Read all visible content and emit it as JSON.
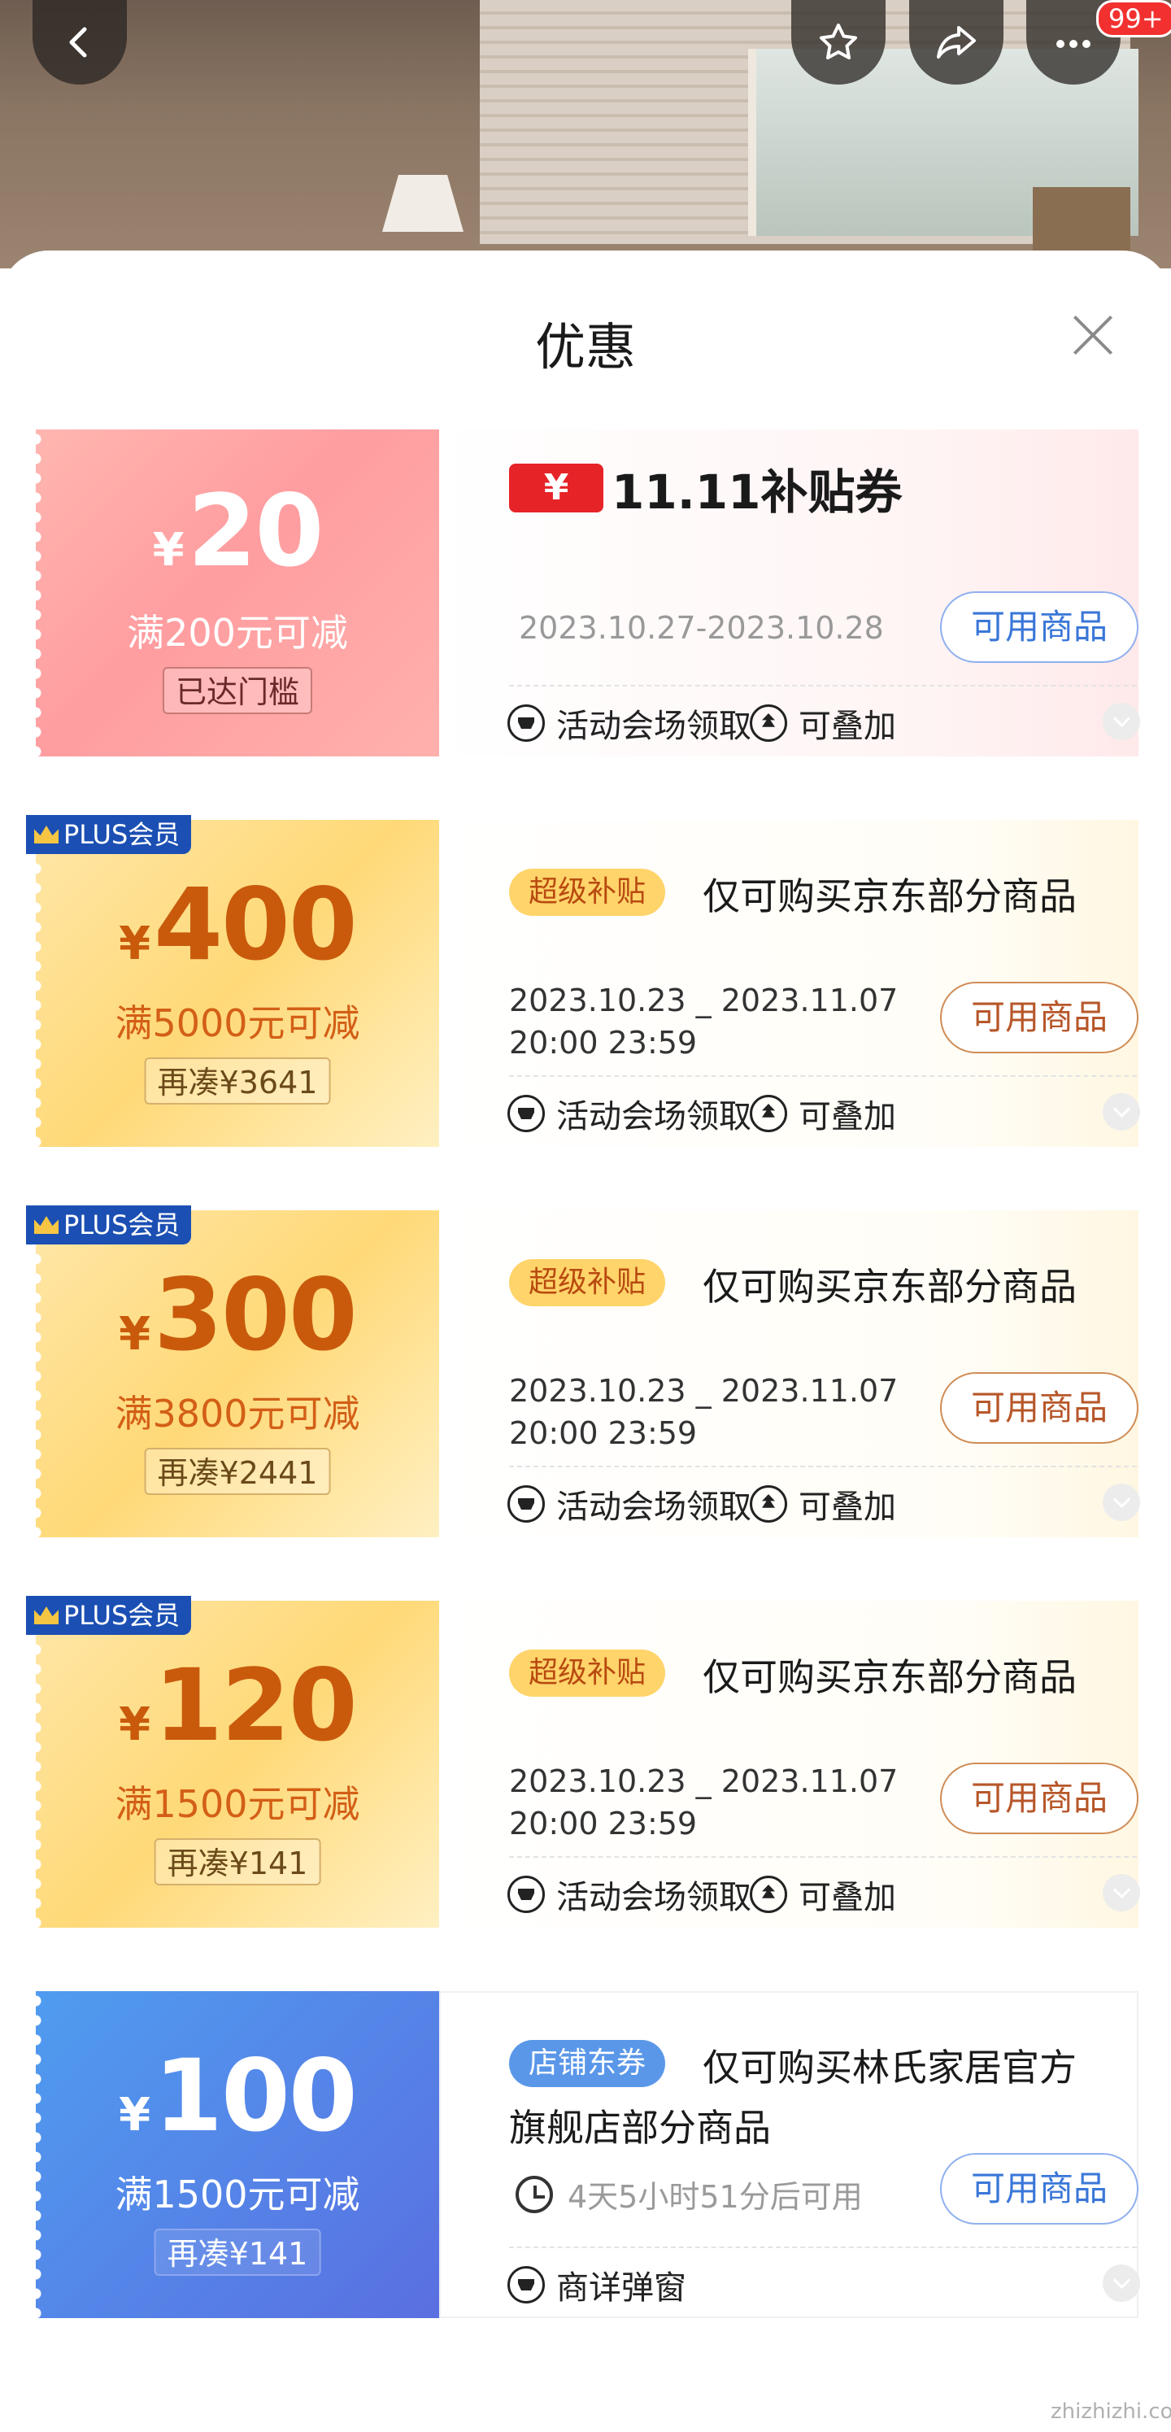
{
  "header": {
    "badge": "99+"
  },
  "sheet": {
    "title": "优惠"
  },
  "coupons": [
    {
      "style": "red",
      "yen": "¥",
      "amount": "20",
      "condition": "满200元可减",
      "tag": "已达门槛",
      "brand_yen": "¥",
      "brand_text": "11.11补贴券",
      "date_line1": "2023.10.27-2023.10.28",
      "button": "可用商品",
      "feat1": "活动会场领取",
      "feat2": "可叠加"
    },
    {
      "style": "gold",
      "plus": "PLUS会员",
      "yen": "¥",
      "amount": "400",
      "condition": "满5000元可减",
      "tag": "再凑¥3641",
      "pill": "超级补贴",
      "title": "仅可购买京东部分商品",
      "date_line1": "2023.10.23 _ 2023.11.07",
      "date_line2": "20:00 23:59",
      "button": "可用商品",
      "feat1": "活动会场领取",
      "feat2": "可叠加"
    },
    {
      "style": "gold",
      "plus": "PLUS会员",
      "yen": "¥",
      "amount": "300",
      "condition": "满3800元可减",
      "tag": "再凑¥2441",
      "pill": "超级补贴",
      "title": "仅可购买京东部分商品",
      "date_line1": "2023.10.23 _ 2023.11.07",
      "date_line2": "20:00 23:59",
      "button": "可用商品",
      "feat1": "活动会场领取",
      "feat2": "可叠加"
    },
    {
      "style": "gold",
      "plus": "PLUS会员",
      "yen": "¥",
      "amount": "120",
      "condition": "满1500元可减",
      "tag": "再凑¥141",
      "pill": "超级补贴",
      "title": "仅可购买京东部分商品",
      "date_line1": "2023.10.23 _ 2023.11.07",
      "date_line2": "20:00 23:59",
      "button": "可用商品",
      "feat1": "活动会场领取",
      "feat2": "可叠加"
    },
    {
      "style": "blue",
      "yen": "¥",
      "amount": "100",
      "condition": "满1500元可减",
      "tag": "再凑¥141",
      "pill": "店铺东券",
      "title": "仅可购买林氏家居官方",
      "title_line2": "旗舰店部分商品",
      "timer": "4天5小时51分后可用",
      "button": "可用商品",
      "feat1": "商详弹窗"
    }
  ],
  "watermark": "zhizhizhi.com"
}
